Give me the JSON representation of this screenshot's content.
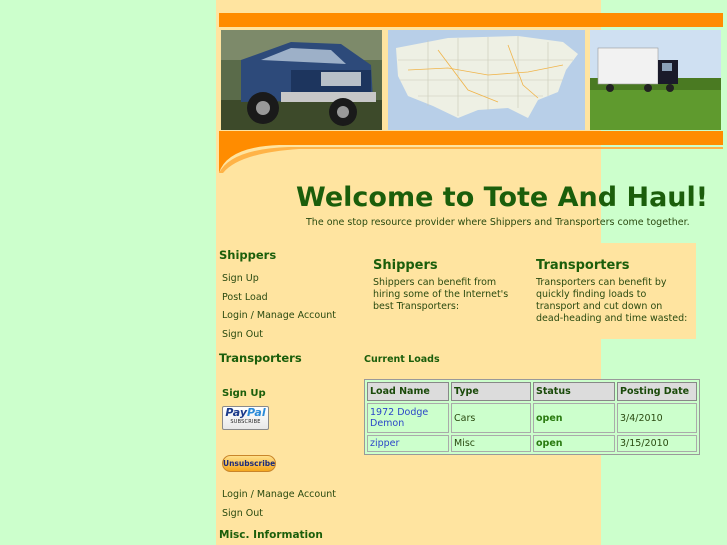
{
  "site": {
    "welcome": "Welcome to Tote And Haul!",
    "tagline": "The one stop resource provider where Shippers and Transporters come together."
  },
  "sidebar": {
    "shippers_heading": "Shippers",
    "shippers_links": [
      "Sign Up",
      "Post Load",
      "Login / Manage Account",
      "Sign Out"
    ],
    "transporters_heading": "Transporters",
    "transporters_signup": "Sign Up",
    "paypal": {
      "brand_a": "Pay",
      "brand_b": "Pal",
      "sub": "SUBSCRIBE"
    },
    "unsubscribe": "Unsubscribe",
    "transporters_links": [
      "Login / Manage Account",
      "Sign Out"
    ],
    "misc_heading": "Misc. Information"
  },
  "info": {
    "shippers_title": "Shippers",
    "shippers_text": "Shippers can benefit from hiring some of the Internet's best Transporters:",
    "transporters_title": "Transporters",
    "transporters_text": "Transporters can benefit by quickly finding loads to transport and cut down on dead-heading and time wasted:"
  },
  "loads": {
    "title": "Current Loads",
    "headers": [
      "Load Name",
      "Type",
      "Status",
      "Posting Date"
    ],
    "rows": [
      {
        "name": "1972 Dodge Demon",
        "type": "Cars",
        "status": "open",
        "date": "3/4/2010"
      },
      {
        "name": "zipper",
        "type": "Misc",
        "status": "open",
        "date": "3/15/2010"
      }
    ]
  },
  "colors": {
    "background": "#ccffcc",
    "content": "#ffe4a0",
    "accent": "#ff8c00",
    "heading": "#1b5e0b"
  }
}
